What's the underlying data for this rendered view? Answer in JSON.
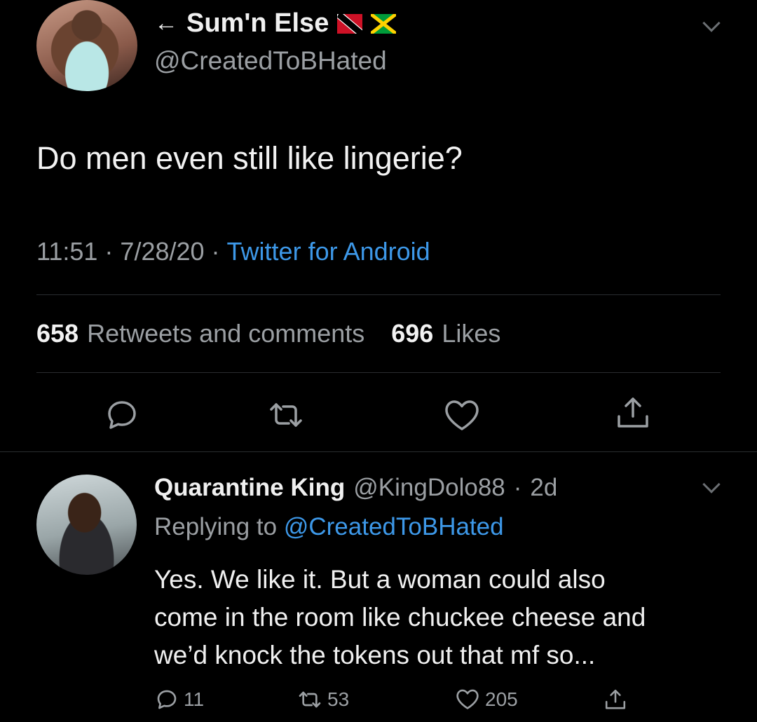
{
  "tweet": {
    "display_name": "Sum'n Else",
    "back_arrow": "←",
    "handle": "@CreatedToBHated",
    "text": "Do men even still like lingerie?",
    "time": "11:51",
    "date": "7/28/20",
    "separator": "·",
    "source": "Twitter for Android",
    "retweets_count": "658",
    "retweets_label": "Retweets and comments",
    "likes_count": "696",
    "likes_label": "Likes",
    "actions": [
      "reply-icon",
      "retweet-icon",
      "like-icon",
      "share-icon"
    ]
  },
  "reply": {
    "display_name": "Quarantine King",
    "handle": "@KingDolo88",
    "age": "2d",
    "separator": "·",
    "replying_prefix": "Replying to",
    "replying_to": "@CreatedToBHated",
    "text_line1": "Yes. We like it. But a woman could also",
    "text_line2": "come in the room like chuckee cheese and",
    "text_line3": "we’d knock the tokens out that mf so...",
    "reply_count": "11",
    "retweet_count": "53",
    "like_count": "205"
  },
  "colors": {
    "background": "#000000",
    "link": "#3d98e8",
    "muted": "#9b9fa3",
    "text": "#f0f0f0"
  }
}
